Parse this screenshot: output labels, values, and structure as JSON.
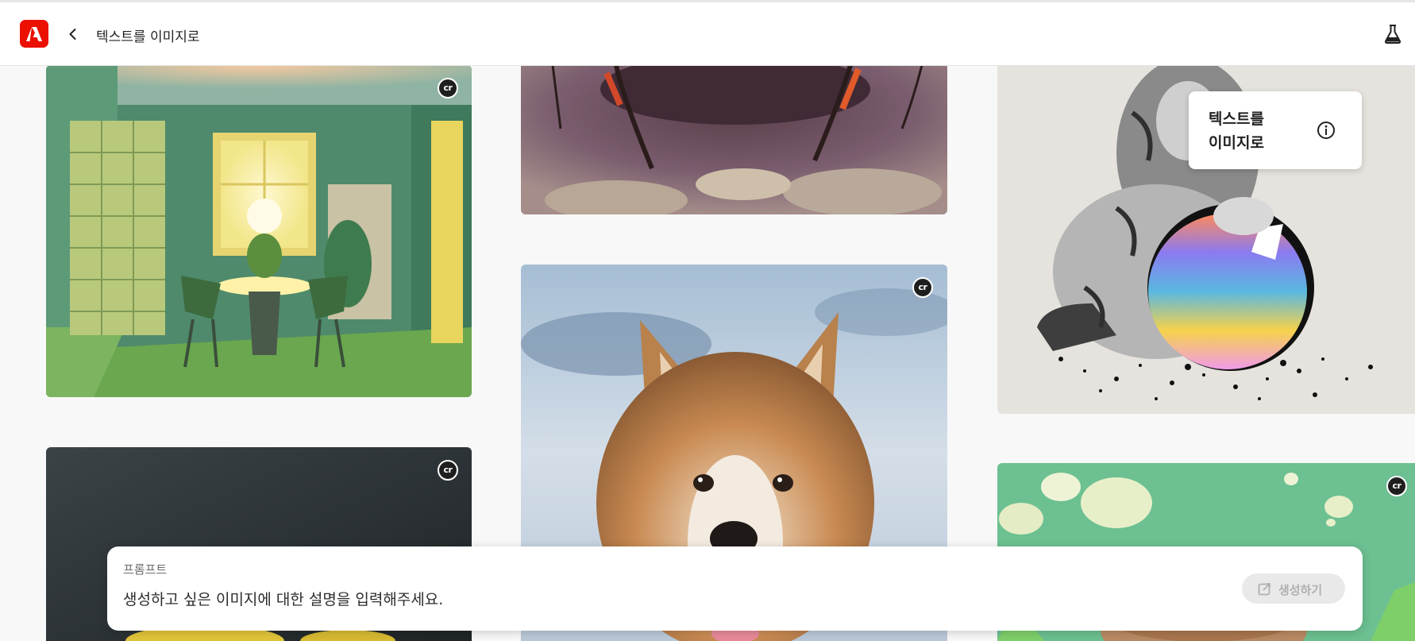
{
  "header": {
    "title": "텍스트를 이미지로",
    "brand_color": "#eb1000"
  },
  "tooltip": {
    "title_line1": "텍스트를",
    "title_line2": "이미지로",
    "icon": "info-icon"
  },
  "gallery": {
    "badge": "cr",
    "cards": [
      {
        "subject": "green-room"
      },
      {
        "subject": "insect-legs"
      },
      {
        "subject": "cat-with-ball"
      },
      {
        "subject": "dark-car"
      },
      {
        "subject": "dog"
      },
      {
        "subject": "mushroom-clouds"
      }
    ]
  },
  "prompt": {
    "label": "프롬프트",
    "placeholder": "생성하고 싶은 이미지에 대한 설명을 입력해주세요.",
    "value": "",
    "generate_label": "생성하기"
  }
}
